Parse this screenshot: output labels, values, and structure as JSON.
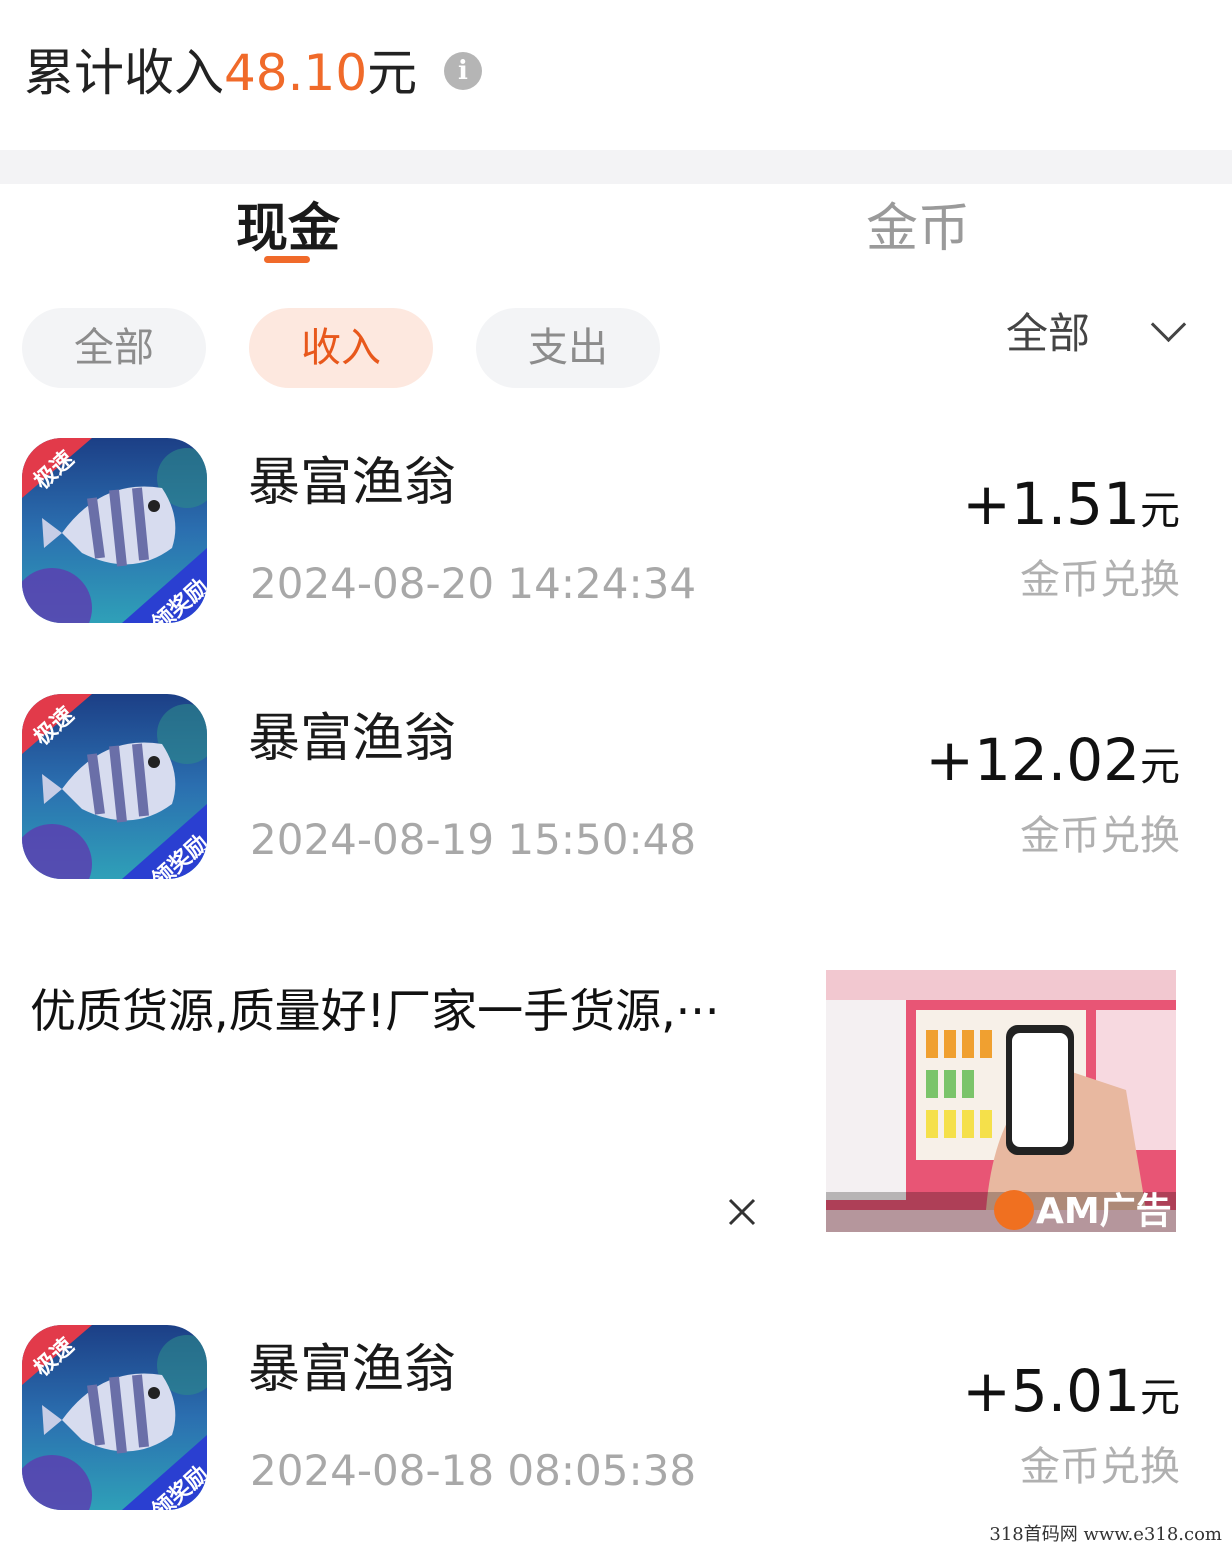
{
  "summary": {
    "label": "累计收入",
    "amount": "48.10",
    "unit": "元",
    "info_glyph": "i"
  },
  "tabs": [
    {
      "label": "现金",
      "active": true
    },
    {
      "label": "金币",
      "active": false
    }
  ],
  "filters": {
    "chips": [
      {
        "label": "全部",
        "active": false
      },
      {
        "label": "收入",
        "active": true
      },
      {
        "label": "支出",
        "active": false
      }
    ],
    "range_select": "全部"
  },
  "transactions": [
    {
      "title": "暴富渔翁",
      "time": "2024-08-20 14:24:34",
      "amount": "+1.51",
      "unit": "元",
      "note": "金币兑换",
      "icon": "fish-game-app-icon",
      "icon_badge_top": "极速",
      "icon_badge_bottom": "领奖励"
    },
    {
      "title": "暴富渔翁",
      "time": "2024-08-19 15:50:48",
      "amount": "+12.02",
      "unit": "元",
      "note": "金币兑换",
      "icon": "fish-game-app-icon",
      "icon_badge_top": "极速",
      "icon_badge_bottom": "领奖励"
    },
    {
      "title": "暴富渔翁",
      "time": "2024-08-18 08:05:38",
      "amount": "+5.01",
      "unit": "元",
      "note": "金币兑换",
      "icon": "fish-game-app-icon",
      "icon_badge_top": "极速",
      "icon_badge_bottom": "领奖励"
    }
  ],
  "ad": {
    "text": "优质货源,质量好!厂家一手货源,···",
    "badge": "AM广告",
    "close_icon": "close-icon"
  },
  "watermark": "318首码网  www.e318.com",
  "colors": {
    "accent": "#f06a2a",
    "chip_active_bg": "#fde8df",
    "muted_text": "#a8a8a8"
  }
}
